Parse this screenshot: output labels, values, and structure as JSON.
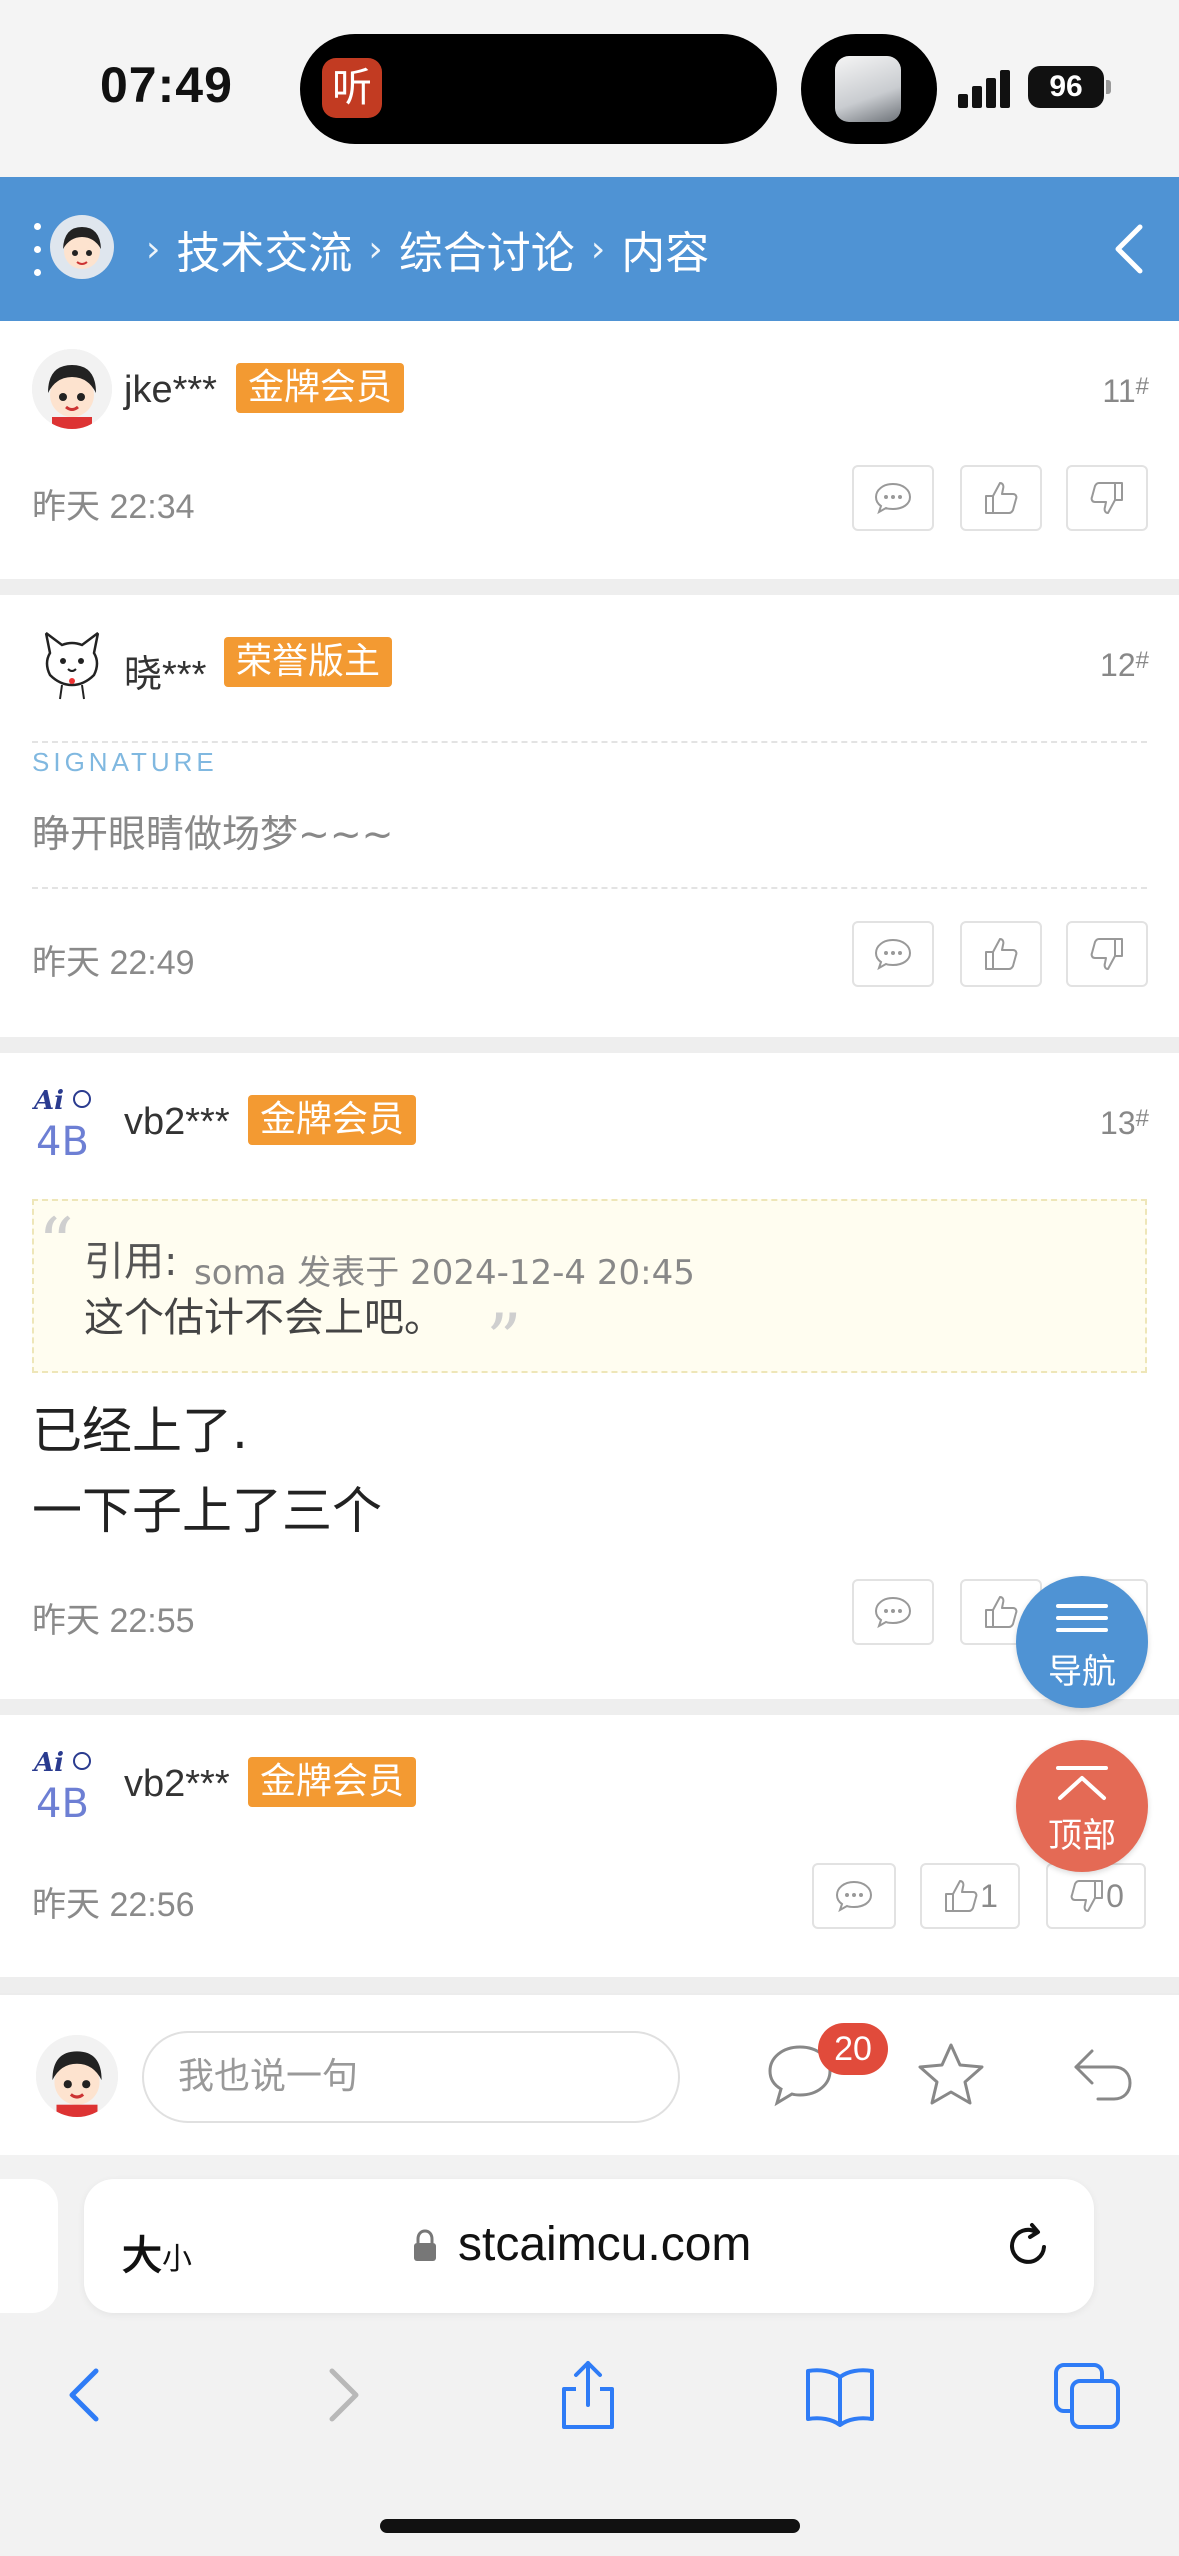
{
  "status": {
    "time": "07:49",
    "island_app": "听",
    "battery": "96"
  },
  "header": {
    "crumbs": [
      "技术交流",
      "综合讨论",
      "内容"
    ],
    "separator": "›"
  },
  "posts": [
    {
      "user": "jke***",
      "badge": "金牌会员",
      "floor": "11",
      "floor_mark": "#",
      "time": "昨天 22:34"
    },
    {
      "user": "晓***",
      "badge": "荣誉版主",
      "floor": "12",
      "floor_mark": "#",
      "signature_label": "SIGNATURE",
      "signature": "睁开眼睛做场梦~~~",
      "time": "昨天 22:49"
    },
    {
      "user": "vb2***",
      "badge": "金牌会员",
      "floor": "13",
      "floor_mark": "#",
      "quote": {
        "label": "引用:",
        "meta": "soma 发表于 2024-12-4 20:45",
        "text": "这个估计不会上吧。"
      },
      "body": [
        "已经上了.",
        "一下子上了三个"
      ],
      "time": "昨天 22:55"
    },
    {
      "user": "vb2***",
      "badge": "金牌会员",
      "time": "昨天 22:56",
      "like_count": "1",
      "dislike_count": "0"
    }
  ],
  "fab": {
    "nav_label": "导航",
    "top_label": "顶部"
  },
  "comment_bar": {
    "placeholder": "我也说一句",
    "comment_count": "20"
  },
  "browser": {
    "size_label": "大",
    "size_small": "小",
    "url": "stcaimcu.com"
  },
  "colors": {
    "header": "#4f93d4",
    "badge": "#f39a32",
    "fab_nav": "#4f93d4",
    "fab_top": "#e46a55",
    "count_badge": "#e14b3b"
  }
}
